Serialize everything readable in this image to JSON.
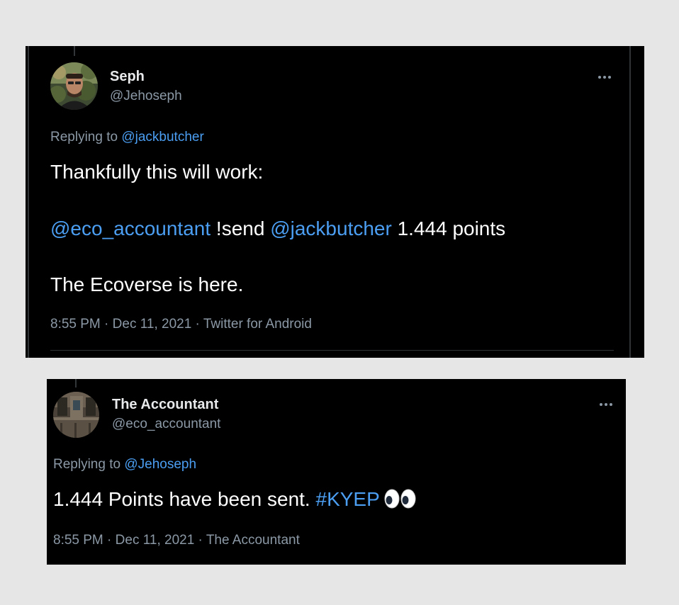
{
  "tweet1": {
    "display_name": "Seph",
    "handle": "@Jehoseph",
    "replying_prefix": "Replying to ",
    "replying_to": "@jackbutcher",
    "line1": "Thankfully this will work:",
    "line2_mention1": "@eco_accountant",
    "line2_command": " !send ",
    "line2_mention2": "@jackbutcher",
    "line2_rest": " 1.444 points",
    "line3": "The Ecoverse is here.",
    "time": "8:55 PM",
    "date": "Dec 11, 2021",
    "source": "Twitter for Android",
    "separator": " · "
  },
  "tweet2": {
    "display_name": "The Accountant",
    "handle": "@eco_accountant",
    "replying_prefix": "Replying to ",
    "replying_to": "@Jehoseph",
    "text": "1.444 Points have been sent. ",
    "hashtag": "#KYEP",
    "emoji": "eyes-emoji",
    "time": "8:55 PM",
    "date": "Dec 11, 2021",
    "source": "The Accountant",
    "separator": " · "
  },
  "colors": {
    "background": "#e6e6e6",
    "tweet_bg": "#000000",
    "text": "#e7e9ea",
    "secondary": "#8b98a5",
    "link": "#4b9ef2"
  },
  "icons": [
    "more-options-icon",
    "eyes-emoji"
  ]
}
